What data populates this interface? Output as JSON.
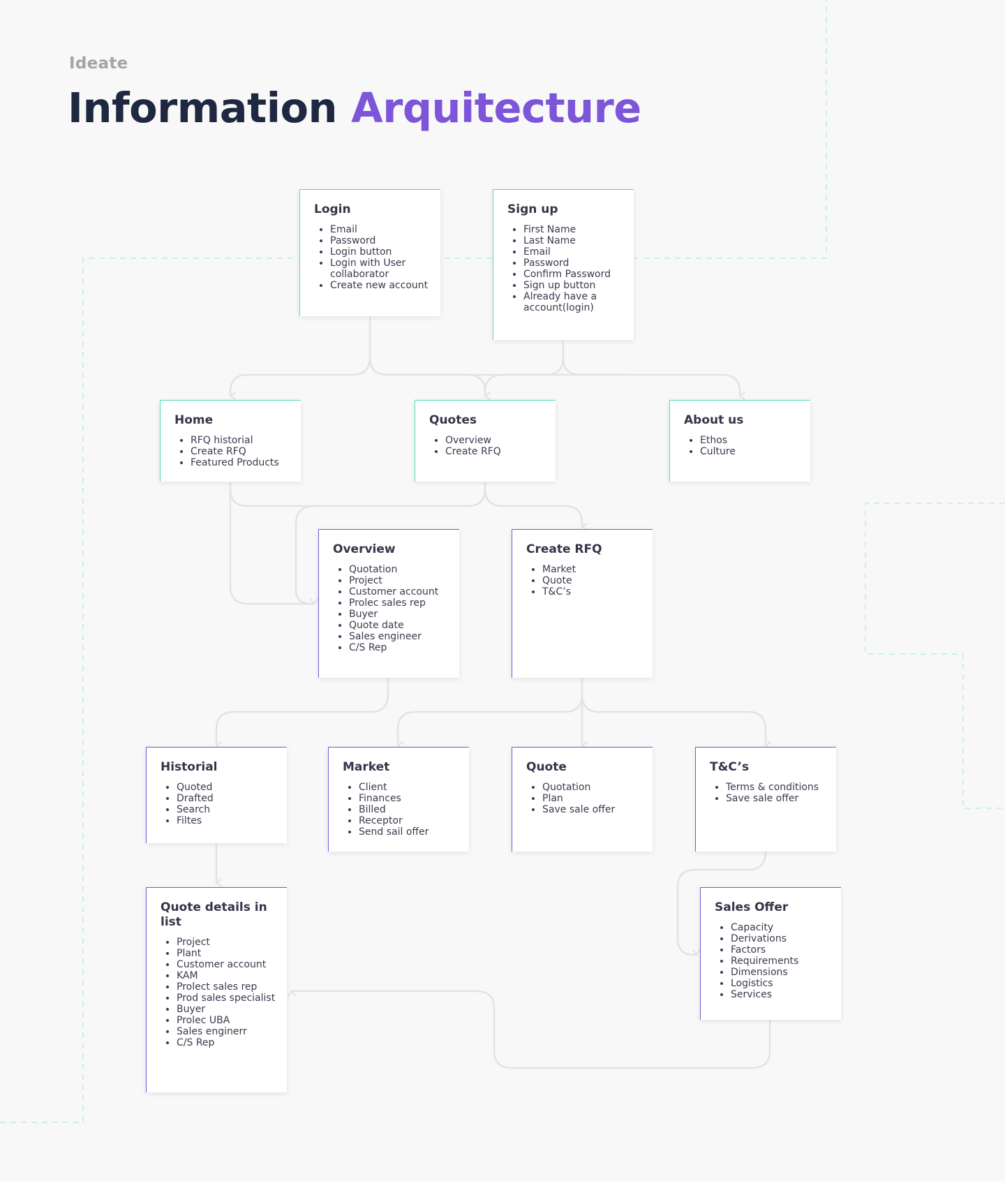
{
  "header": {
    "eyebrow": "Ideate",
    "title_part1": "Information",
    "title_part2": "Arquitecture"
  },
  "colors": {
    "title_dark": "#1e2840",
    "accent_purple": "#7c55d8",
    "accent_green": "#4fe0b0",
    "connector": "#e3e3e6"
  },
  "cards": {
    "login": {
      "title": "Login",
      "items": [
        "Email",
        "Password",
        "Login button",
        "Login with User collaborator",
        "Create new account"
      ]
    },
    "signup": {
      "title": "Sign up",
      "items": [
        "First Name",
        "Last Name",
        "Email",
        "Password",
        "Confirm Password",
        "Sign up button",
        "Already have a account(login)"
      ]
    },
    "home": {
      "title": "Home",
      "items": [
        "RFQ historial",
        "Create RFQ",
        "Featured Products"
      ]
    },
    "quotes": {
      "title": "Quotes",
      "items": [
        "Overview",
        "Create RFQ"
      ]
    },
    "about": {
      "title": "About us",
      "items": [
        "Ethos",
        "Culture"
      ]
    },
    "overview": {
      "title": "Overview",
      "items": [
        "Quotation",
        "Project",
        "Customer account",
        "Prolec sales rep",
        "Buyer",
        "Quote date",
        "Sales engineer",
        "C/S Rep"
      ]
    },
    "create_rfq": {
      "title": "Create RFQ",
      "items": [
        "Market",
        "Quote",
        "T&C’s"
      ]
    },
    "historial": {
      "title": "Historial",
      "items": [
        "Quoted",
        "Drafted",
        "Search",
        "Filtes"
      ]
    },
    "market": {
      "title": "Market",
      "items": [
        "Client",
        "Finances",
        "Billed",
        "Receptor",
        "Send sail offer"
      ]
    },
    "quote": {
      "title": "Quote",
      "items": [
        "Quotation",
        "Plan",
        "Save sale offer"
      ]
    },
    "tcs": {
      "title": "T&C’s",
      "items": [
        "Terms & conditions",
        "Save sale offer"
      ]
    },
    "quote_details": {
      "title": "Quote details in list",
      "items": [
        "Project",
        "Plant",
        "Customer account",
        "KAM",
        "Prolect sales rep",
        "Prod sales specialist",
        "Buyer",
        "Prolec UBA",
        "Sales enginerr",
        "C/S Rep"
      ]
    },
    "sales_offer": {
      "title": "Sales Offer",
      "items": [
        "Capacity",
        "Derivations",
        "Factors",
        "Requirements",
        "Dimensions",
        "Logistics",
        "Services"
      ]
    }
  },
  "connections": [
    [
      "login",
      "home"
    ],
    [
      "login",
      "quotes"
    ],
    [
      "login",
      "about"
    ],
    [
      "signup",
      "home"
    ],
    [
      "signup",
      "quotes"
    ],
    [
      "signup",
      "about"
    ],
    [
      "home",
      "overview"
    ],
    [
      "quotes",
      "overview"
    ],
    [
      "quotes",
      "create_rfq"
    ],
    [
      "overview",
      "historial"
    ],
    [
      "create_rfq",
      "market"
    ],
    [
      "create_rfq",
      "quote"
    ],
    [
      "create_rfq",
      "tcs"
    ],
    [
      "historial",
      "quote_details"
    ],
    [
      "tcs",
      "sales_offer"
    ],
    [
      "sales_offer",
      "quote_details"
    ]
  ]
}
